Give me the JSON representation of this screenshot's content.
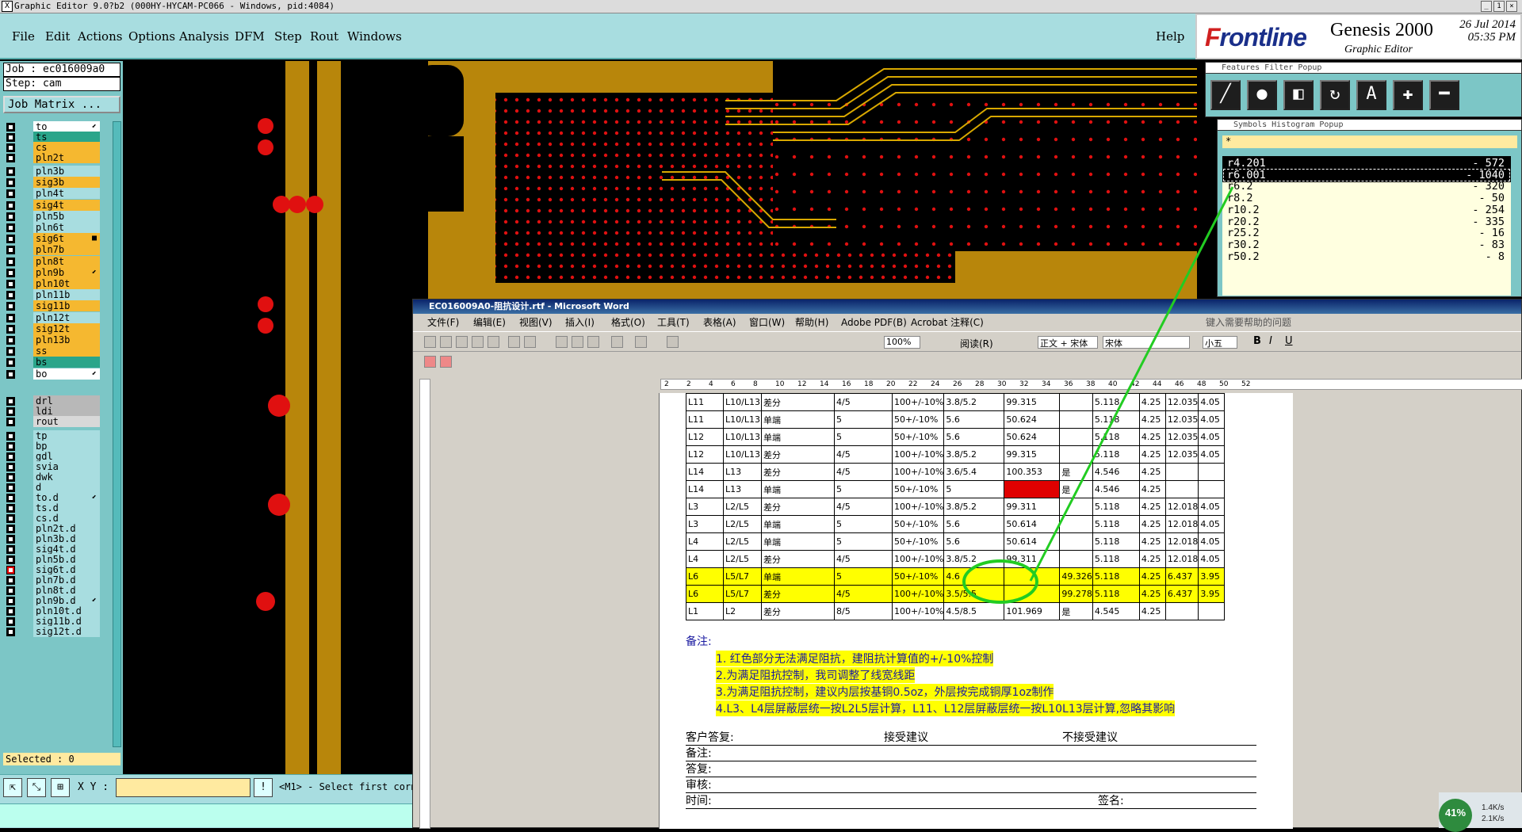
{
  "titlebar": {
    "text": "Graphic Editor 9.0?b2 (000HY-HYCAM-PC066 - Windows, pid:4084)",
    "controls": [
      "_",
      "1",
      "×"
    ]
  },
  "menu": {
    "items": [
      "File",
      "Edit",
      "Actions",
      "Options",
      "Analysis",
      "DFM",
      "Step",
      "Rout",
      "Windows"
    ],
    "help": "Help"
  },
  "brand": {
    "logo_prefix": "F",
    "logo_rest": "rontline",
    "product": "Genesis 2000",
    "editor": "Graphic Editor",
    "date": "26 Jul 2014",
    "time": "05:35 PM"
  },
  "job": {
    "job_label": "Job : ec016009a0",
    "step_label": "Step: cam",
    "matrix_button": "Job Matrix ..."
  },
  "layers": [
    {
      "name": "to",
      "color": "#ffffff",
      "mark": "⬋"
    },
    {
      "name": "ts",
      "color": "#2aa58a"
    },
    {
      "name": "cs",
      "color": "#f5b830"
    },
    {
      "name": "pln2t",
      "color": "#f5b830"
    },
    {
      "name": "pln3b",
      "color": "#a8dde0"
    },
    {
      "name": "sig3b",
      "color": "#f5b830"
    },
    {
      "name": "pln4t",
      "color": "#a8dde0"
    },
    {
      "name": "sig4t",
      "color": "#f5b830"
    },
    {
      "name": "pln5b",
      "color": "#a8dde0"
    },
    {
      "name": "pln6t",
      "color": "#a8dde0"
    },
    {
      "name": "sig6t",
      "color": "#f5b830",
      "mark": "■"
    },
    {
      "name": "pln7b",
      "color": "#f5b830"
    },
    {
      "name": "pln8t",
      "color": "#f5b830"
    },
    {
      "name": "pln9b",
      "color": "#f5b830",
      "mark": "⬋"
    },
    {
      "name": "pln10t",
      "color": "#f5b830"
    },
    {
      "name": "pln11b",
      "color": "#a8dde0"
    },
    {
      "name": "sig11b",
      "color": "#f5b830"
    },
    {
      "name": "pln12t",
      "color": "#a8dde0"
    },
    {
      "name": "sig12t",
      "color": "#f5b830"
    },
    {
      "name": "pln13b",
      "color": "#f5b830"
    },
    {
      "name": "ss",
      "color": "#f5b830"
    },
    {
      "name": "bs",
      "color": "#2aa58a"
    },
    {
      "name": "bo",
      "color": "#ffffff",
      "mark": "⬋"
    },
    {
      "name": "drl",
      "color": "#b8b8b8"
    },
    {
      "name": "ldi",
      "color": "#b8b8b8"
    },
    {
      "name": "rout",
      "color": "#d8d8d8"
    },
    {
      "name": "tp",
      "color": "#a8dde0"
    },
    {
      "name": "bp",
      "color": "#a8dde0"
    },
    {
      "name": "gdl",
      "color": "#a8dde0"
    },
    {
      "name": "svia",
      "color": "#a8dde0"
    },
    {
      "name": "dwk",
      "color": "#a8dde0"
    },
    {
      "name": "d",
      "color": "#a8dde0"
    },
    {
      "name": "to.d",
      "color": "#a8dde0",
      "mark": "⬋"
    },
    {
      "name": "ts.d",
      "color": "#a8dde0"
    },
    {
      "name": "cs.d",
      "color": "#a8dde0"
    },
    {
      "name": "pln2t.d",
      "color": "#a8dde0"
    },
    {
      "name": "pln3b.d",
      "color": "#a8dde0"
    },
    {
      "name": "sig4t.d",
      "color": "#a8dde0"
    },
    {
      "name": "pln5b.d",
      "color": "#a8dde0"
    },
    {
      "name": "sig6t.d",
      "color": "#a8dde0",
      "box": "#e00000"
    },
    {
      "name": "pln7b.d",
      "color": "#a8dde0"
    },
    {
      "name": "pln8t.d",
      "color": "#a8dde0"
    },
    {
      "name": "pln9b.d",
      "color": "#a8dde0",
      "mark": "⬋"
    },
    {
      "name": "pln10t.d",
      "color": "#a8dde0"
    },
    {
      "name": "sig11b.d",
      "color": "#a8dde0"
    },
    {
      "name": "sig12t.d",
      "color": "#a8dde0"
    }
  ],
  "selected": "Selected : 0",
  "status": {
    "xy_label": "X Y :",
    "xy_value": "",
    "message": "<M1> - Select first corn"
  },
  "features_filter": {
    "title": "Features Filter Popup",
    "buttons": [
      "line-icon",
      "pad-icon",
      "surface-icon",
      "arc-icon",
      "text-icon",
      "plus-icon",
      "minus-icon"
    ]
  },
  "symbols_histogram": {
    "title": "Symbols Histogram Popup",
    "filter": "*",
    "rows": [
      {
        "symbol": "r4.201",
        "count": "- 572",
        "selected": true
      },
      {
        "symbol": "r6.001",
        "count": "- 1040",
        "selected": true
      },
      {
        "symbol": "r6.2",
        "count": "- 320"
      },
      {
        "symbol": "r8.2",
        "count": "- 50"
      },
      {
        "symbol": "r10.2",
        "count": "- 254"
      },
      {
        "symbol": "r20.2",
        "count": "- 335"
      },
      {
        "symbol": "r25.2",
        "count": "- 16"
      },
      {
        "symbol": "r30.2",
        "count": "- 83"
      },
      {
        "symbol": "r50.2",
        "count": "- 8"
      }
    ]
  },
  "word": {
    "title": "EC016009A0-阻抗设计.rtf - Microsoft Word",
    "menu": [
      "文件(F)",
      "编辑(E)",
      "视图(V)",
      "插入(I)",
      "格式(O)",
      "工具(T)",
      "表格(A)",
      "窗口(W)",
      "帮助(H)",
      "Adobe PDF(B)",
      "Acrobat 注释(C)"
    ],
    "help_search": "键入需要帮助的问题",
    "zoom": "100%",
    "read": "阅读(R)",
    "style": "正文 + 宋体",
    "font": "宋体",
    "size": "小五",
    "ruler": [
      "2",
      "2",
      "4",
      "6",
      "8",
      "10",
      "12",
      "14",
      "16",
      "18",
      "20",
      "22",
      "24",
      "26",
      "28",
      "30",
      "32",
      "34",
      "36",
      "38",
      "40",
      "42",
      "44",
      "46",
      "48",
      "50",
      "52"
    ],
    "table": [
      {
        "cells": [
          "L11",
          "L10/L13",
          "差分",
          "4/5",
          "100+/-10%",
          "3.8/5.2",
          "99.315",
          "",
          "5.118",
          "4.25",
          "12.035",
          "4.05"
        ]
      },
      {
        "cells": [
          "L11",
          "L10/L13",
          "单端",
          "5",
          "50+/-10%",
          "5.6",
          "50.624",
          "",
          "5.118",
          "4.25",
          "12.035",
          "4.05"
        ]
      },
      {
        "cells": [
          "L12",
          "L10/L13",
          "单端",
          "5",
          "50+/-10%",
          "5.6",
          "50.624",
          "",
          "5.118",
          "4.25",
          "12.035",
          "4.05"
        ]
      },
      {
        "cells": [
          "L12",
          "L10/L13",
          "差分",
          "4/5",
          "100+/-10%",
          "3.8/5.2",
          "99.315",
          "",
          "5.118",
          "4.25",
          "12.035",
          "4.05"
        ]
      },
      {
        "cells": [
          "L14",
          "L13",
          "差分",
          "4/5",
          "100+/-10%",
          "3.6/5.4",
          "100.353",
          "是",
          "4.546",
          "4.25",
          "",
          ""
        ]
      },
      {
        "cells": [
          "L14",
          "L13",
          "单端",
          "5",
          "50+/-10%",
          "5",
          "",
          "是",
          "4.546",
          "4.25",
          "",
          ""
        ],
        "red": 6
      },
      {
        "cells": [
          "L3",
          "L2/L5",
          "差分",
          "4/5",
          "100+/-10%",
          "3.8/5.2",
          "99.311",
          "",
          "5.118",
          "4.25",
          "12.018",
          "4.05"
        ]
      },
      {
        "cells": [
          "L3",
          "L2/L5",
          "单端",
          "5",
          "50+/-10%",
          "5.6",
          "50.614",
          "",
          "5.118",
          "4.25",
          "12.018",
          "4.05"
        ]
      },
      {
        "cells": [
          "L4",
          "L2/L5",
          "单端",
          "5",
          "50+/-10%",
          "5.6",
          "50.614",
          "",
          "5.118",
          "4.25",
          "12.018",
          "4.05"
        ]
      },
      {
        "cells": [
          "L4",
          "L2/L5",
          "差分",
          "4/5",
          "100+/-10%",
          "3.8/5.2",
          "99.311",
          "",
          "5.118",
          "4.25",
          "12.018",
          "4.05"
        ]
      },
      {
        "cells": [
          "L6",
          "L5/L7",
          "单端",
          "5",
          "50+/-10%",
          "4.6",
          "",
          "49.326",
          "5.118",
          "4.25",
          "6.437",
          "3.95"
        ],
        "hl": true
      },
      {
        "cells": [
          "L6",
          "L5/L7",
          "差分",
          "4/5",
          "100+/-10%",
          "3.5/5.5",
          "",
          "99.278",
          "5.118",
          "4.25",
          "6.437",
          "3.95"
        ],
        "hl": true
      },
      {
        "cells": [
          "L1",
          "L2",
          "差分",
          "8/5",
          "100+/-10%",
          "4.5/8.5",
          "101.969",
          "是",
          "4.545",
          "4.25",
          "",
          ""
        ]
      }
    ],
    "notes_head": "备注:",
    "notes": [
      "1. 红色部分无法满足阻抗，建阻抗计算值的+/-10%控制",
      "2.为满足阻抗控制，我司调整了线宽线距",
      "3.为满足阻抗控制，建议内层按基铜0.5oz，外层按完成铜厚1oz制作",
      "4.L3、L4层屏蔽层统一按L2L5层计算，L11、L12层屏蔽层统一按L10L13层计算,忽略其影响"
    ],
    "signoff": {
      "customer": "客户答复:",
      "accept": "接受建议",
      "reject": "不接受建议",
      "remark": "备注:",
      "reply": "答复:",
      "review": "审核:",
      "time": "时间:",
      "sign": "签名:"
    }
  },
  "tray": {
    "percent": "41%",
    "up": "1.4K/s",
    "down": "2.1K/s"
  }
}
